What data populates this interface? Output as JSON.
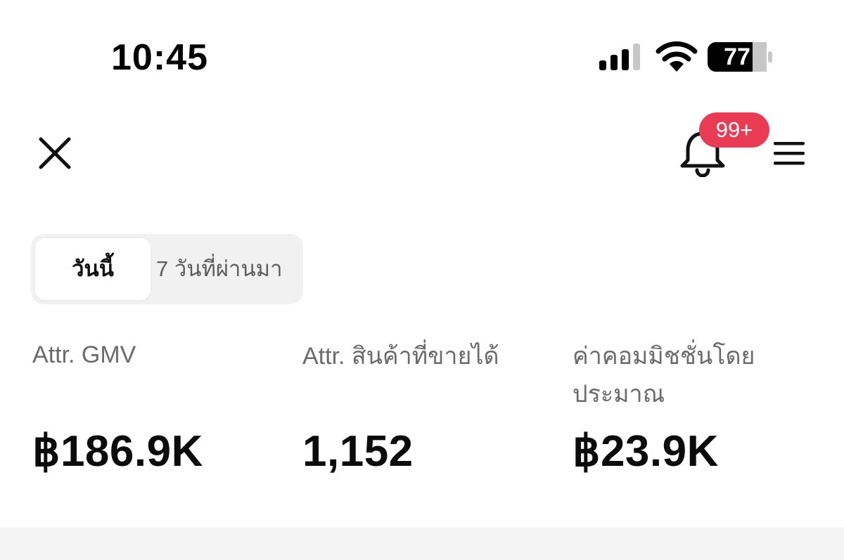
{
  "status_bar": {
    "time": "10:45",
    "battery_level": "77",
    "icons": [
      "signal-icon",
      "wifi-icon",
      "battery-icon"
    ]
  },
  "header": {
    "close_icon": "close-icon",
    "bell_icon": "bell-icon",
    "notification_count": "99+",
    "menu_icon": "hamburger-menu-icon"
  },
  "segment": {
    "tabs": [
      {
        "label": "วันนี้",
        "selected": true
      },
      {
        "label": "7 วันที่ผ่านมา",
        "selected": false
      }
    ]
  },
  "metrics": [
    {
      "label": "Attr. GMV",
      "value": "฿186.9K"
    },
    {
      "label": "Attr. สินค้าที่ขายได้",
      "value": "1,152"
    },
    {
      "label": "ค่าคอมมิชชั่นโดยประมาณ",
      "value": "฿23.9K"
    }
  ],
  "colors": {
    "badge": "#ea3b55",
    "segment_bg": "#f1f1f2",
    "label_text": "#6b6b6b",
    "value_text": "#0b0b0b"
  }
}
